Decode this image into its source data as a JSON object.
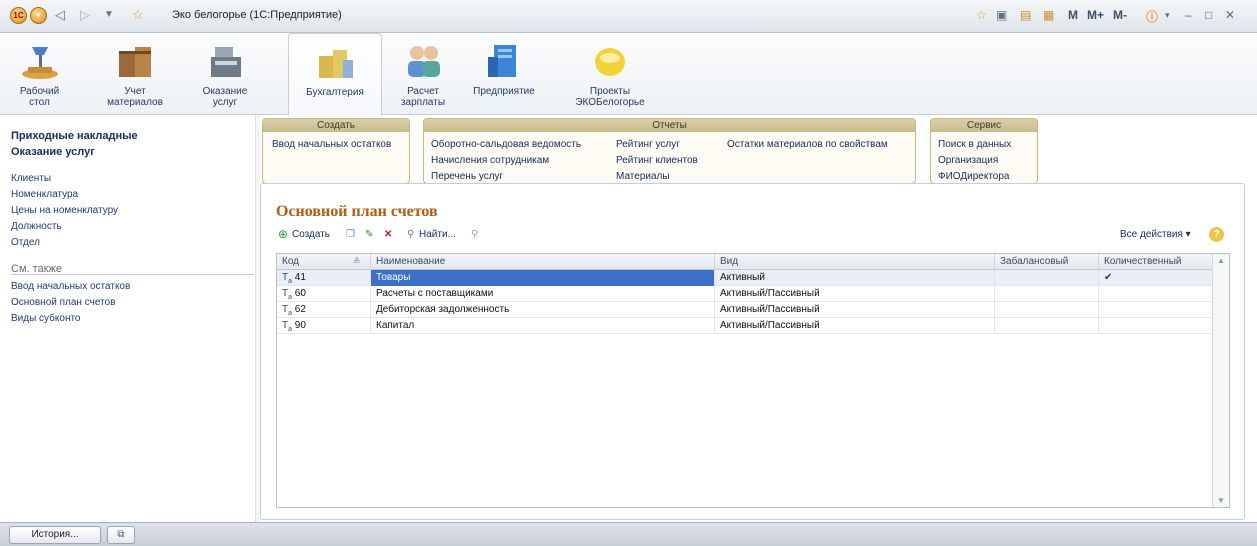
{
  "window": {
    "title": "Эко белогорье  (1С:Предприятие)",
    "toolbar_right": [
      "M",
      "M+",
      "M-"
    ]
  },
  "ribbon": {
    "sections": [
      {
        "id": "desktop",
        "label": "Рабочий\nстол",
        "icon": "desk-lamp-icon"
      },
      {
        "id": "materials",
        "label": "Учет\nматериалов",
        "icon": "boxes-icon"
      },
      {
        "id": "services",
        "label": "Оказание\nуслуг",
        "icon": "cash-register-icon"
      },
      {
        "id": "accounting",
        "label": "Бухгалтерия",
        "icon": "coins-icon",
        "active": true
      },
      {
        "id": "payroll",
        "label": "Расчет\nзарплаты",
        "icon": "people-icon"
      },
      {
        "id": "enterprise",
        "label": "Предприятие",
        "icon": "building-icon"
      },
      {
        "id": "projects",
        "label": "Проекты\nЭКОБелогорье",
        "icon": "yellow-orb-icon"
      }
    ]
  },
  "left_panel": {
    "bold_items": [
      "Приходные накладные",
      "Оказание услуг"
    ],
    "items": [
      "Клиенты",
      "Номенклатура",
      "Цены на номенклатуру",
      "Должность",
      "Отдел"
    ],
    "see_also_label": "См. также",
    "see_also_items": [
      "Ввод начальных остатков",
      "Основной план счетов",
      "Виды субконто"
    ]
  },
  "command_panel": {
    "groups": [
      {
        "title": "Создать",
        "commands": [
          "Ввод начальных остатков"
        ]
      },
      {
        "title": "Отчеты",
        "commands": [
          "Оборотно-сальдовая ведомость",
          "Начисления сотрудникам",
          "Перечень услуг",
          "Рейтинг услуг",
          "Рейтинг клиентов",
          "Материалы",
          "Остатки материалов по свойствам"
        ]
      },
      {
        "title": "Сервис",
        "commands": [
          "Поиск в данных",
          "Организация",
          "ФИОДиректора"
        ]
      }
    ]
  },
  "form": {
    "title": "Основной план счетов",
    "toolbar": {
      "create": "Создать",
      "find": "Найти...",
      "all_actions": "Все действия"
    },
    "table": {
      "columns": [
        "Код",
        "Наименование",
        "Вид",
        "Забалансовый",
        "Количественный"
      ],
      "rows": [
        {
          "code": "41",
          "name": "Товары",
          "kind": "Активный",
          "offbalance": "",
          "quantity": "✔",
          "selected": true
        },
        {
          "code": "60",
          "name": "Расчеты с поставщиками",
          "kind": "Активный/Пассивный",
          "offbalance": "",
          "quantity": ""
        },
        {
          "code": "62",
          "name": "Дебиторская задолженность",
          "kind": "Активный/Пассивный",
          "offbalance": "",
          "quantity": ""
        },
        {
          "code": "90",
          "name": "Капитал",
          "kind": "Активный/Пассивный",
          "offbalance": "",
          "quantity": ""
        }
      ]
    }
  },
  "statusbar": {
    "history": "История..."
  },
  "colors": {
    "accent": "#b05a12",
    "selection": "#3a70c8",
    "link": "#1a2e66"
  }
}
